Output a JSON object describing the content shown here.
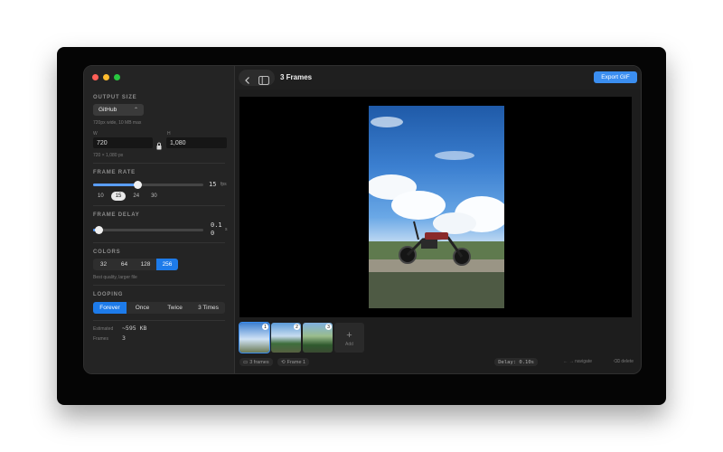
{
  "toolbar": {
    "title": "3 Frames",
    "export_label": "Export GIF"
  },
  "output_size": {
    "section_title": "OUTPUT SIZE",
    "preset": "GitHub",
    "preset_note": "720px wide, 10 MB max",
    "w_label": "W",
    "h_label": "H",
    "width": "720",
    "height": "1,080",
    "size_note": "720 × 1,080 px"
  },
  "frame_rate": {
    "section_title": "FRAME RATE",
    "value": "15",
    "unit": "fps",
    "slider_fraction": 0.4,
    "presets": [
      "10",
      "15",
      "24",
      "30"
    ],
    "active_preset": "15"
  },
  "frame_delay": {
    "section_title": "FRAME DELAY",
    "value_line1": "0.1",
    "value_line2": "0",
    "unit": "s",
    "slider_fraction": 0.05
  },
  "colors": {
    "section_title": "COLORS",
    "options": [
      "32",
      "64",
      "128",
      "256"
    ],
    "active": "256",
    "note": "Best quality, larger file"
  },
  "looping": {
    "section_title": "LOOPING",
    "options": [
      "Forever",
      "Once",
      "Twice",
      "3 Times"
    ],
    "active": "Forever"
  },
  "stats": {
    "estimated_label": "Estimated",
    "estimated_value": "~595 KB",
    "frames_label": "Frames",
    "frames_value": "3"
  },
  "thumbnails": [
    {
      "number": "1"
    },
    {
      "number": "2"
    },
    {
      "number": "3"
    }
  ],
  "add_label": "Add",
  "status": {
    "frames": "3 frames",
    "current_frame": "Frame 1",
    "delay": "Delay: 0.10s",
    "navigate_hint": "← → navigate",
    "delete_hint": "⌫ delete"
  },
  "colors_theme": {
    "accent": "#3b8ef0",
    "segment_active": "#1d7bea",
    "slider": "#5a9dff"
  }
}
